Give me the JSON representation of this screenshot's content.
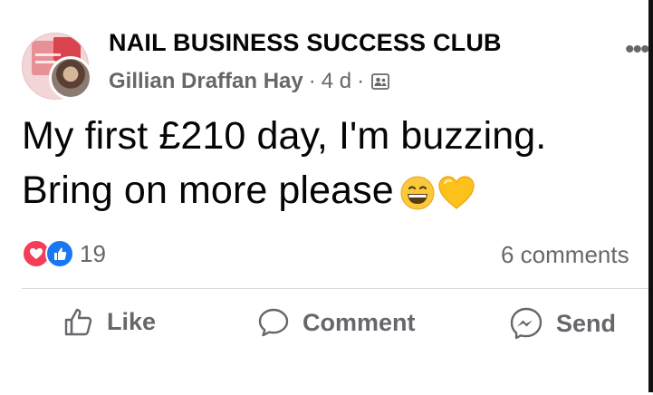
{
  "post": {
    "group_name": "NAIL BUSINESS SUCCESS CLUB",
    "author": "Gillian Draffan Hay",
    "separator": "·",
    "time": "4 d",
    "privacy_icon": "members-group-icon",
    "more_icon": "more-horizontal-icon",
    "text_line1": "My first £210 day, I'm buzzing.",
    "text_line2": "Bring on more please",
    "emojis": [
      "grinning-face-emoji",
      "yellow-heart-emoji"
    ]
  },
  "reactions": {
    "types": [
      "love",
      "like"
    ],
    "count": "19",
    "comments_label": "6 comments"
  },
  "actions": {
    "like_label": "Like",
    "comment_label": "Comment",
    "send_label": "Send"
  },
  "colors": {
    "text": "#050505",
    "secondary": "#65676b",
    "love": "#f33e58",
    "like": "#1877f2",
    "divider": "#d8d9dc"
  }
}
